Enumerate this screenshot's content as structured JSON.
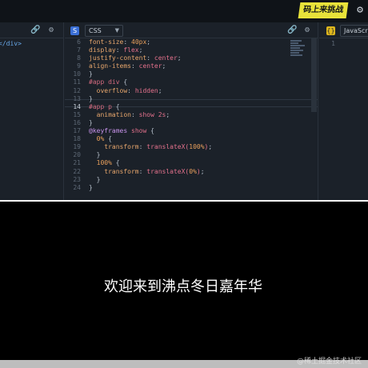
{
  "topbar": {
    "logo_text": "码上来挑战",
    "settings_icon": "gear-icon"
  },
  "html_pane": {
    "visible_code": "</div>",
    "icons": [
      "link-icon",
      "gear-icon"
    ]
  },
  "css_pane": {
    "badge": "S",
    "language": "CSS",
    "icons": [
      "link-icon",
      "gear-icon"
    ],
    "line_numbers": [
      "6",
      "7",
      "8",
      "9",
      "10",
      "11",
      "12",
      "13",
      "14",
      "15",
      "16",
      "17",
      "18",
      "19",
      "20",
      "21",
      "22",
      "23",
      "24"
    ]
  },
  "js_pane": {
    "badge": "{}",
    "language": "JavaScript",
    "line_numbers": [
      "1"
    ]
  },
  "preview": {
    "text": "欢迎来到沸点冬日嘉年华"
  },
  "watermark": "@稀土掘金技术社区"
}
